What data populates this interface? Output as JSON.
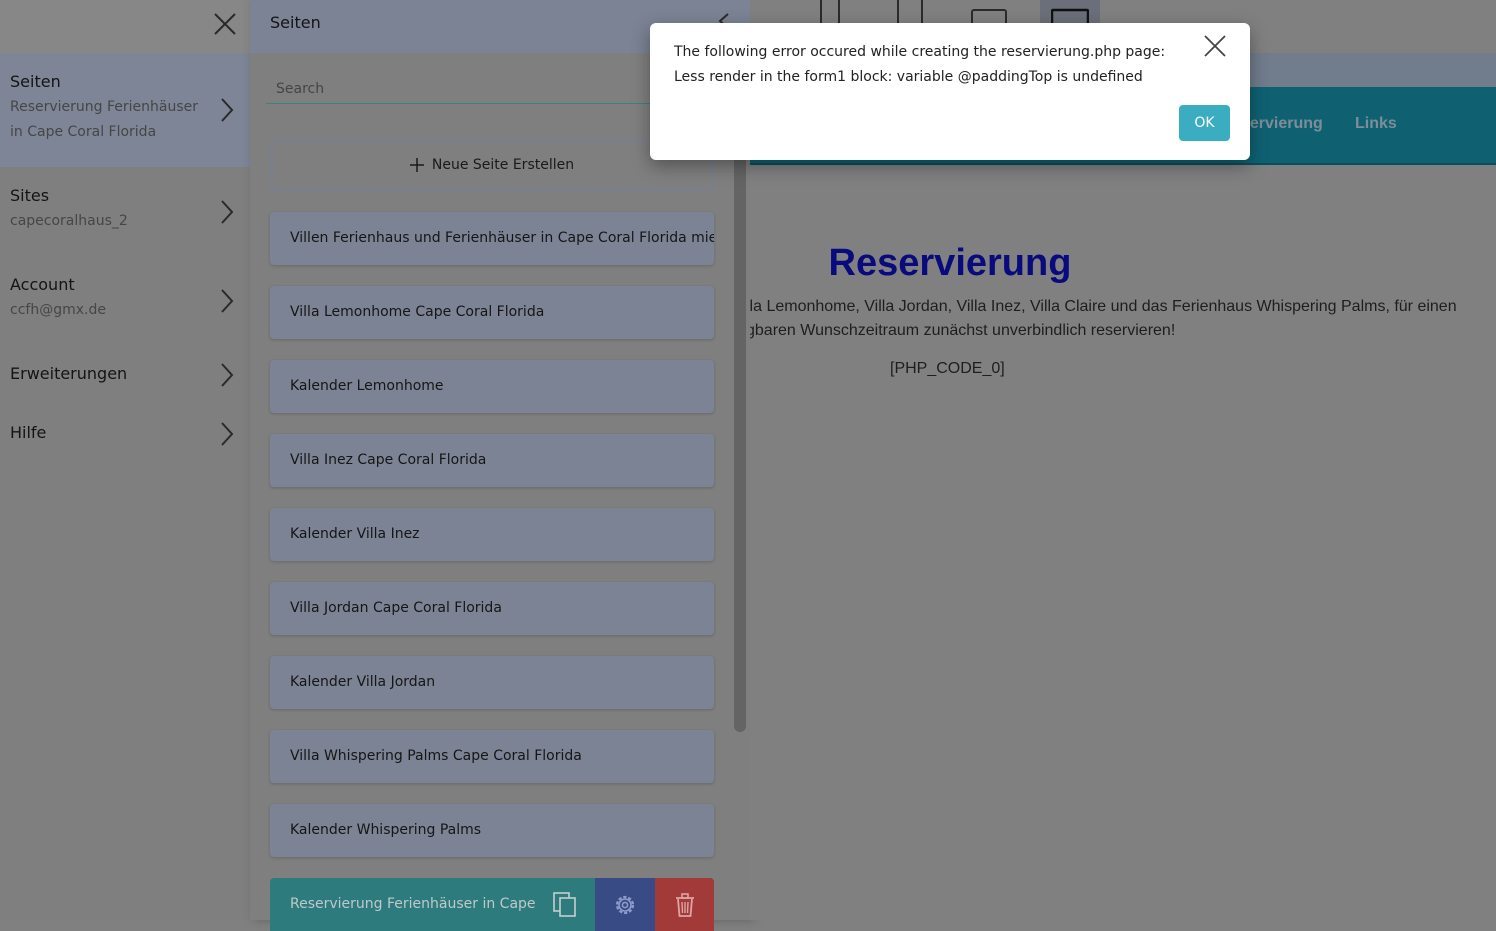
{
  "nav": {
    "items": [
      {
        "label": "Seiten",
        "sub": "Reservierung Ferienhäuser in Cape Coral Florida"
      },
      {
        "label": "Sites",
        "sub": "capecoralhaus_2"
      },
      {
        "label": "Account",
        "sub": "ccfh@gmx.de"
      },
      {
        "label": "Erweiterungen"
      },
      {
        "label": "Hilfe"
      }
    ]
  },
  "pages": {
    "title": "Seiten",
    "search_placeholder": "Search",
    "new_page_label": "Neue Seite Erstellen",
    "items": [
      "Villen Ferienhaus und Ferienhäuser in Cape Coral Florida mieten",
      "Villa Lemonhome Cape Coral Florida",
      "Kalender Lemonhome",
      "Villa Inez Cape Coral Florida",
      "Kalender Villa Inez",
      "Villa Jordan Cape Coral Florida",
      "Kalender Villa Jordan",
      "Villa Whispering Palms Cape Coral Florida",
      "Kalender Whispering Palms"
    ],
    "active_item": "Reservierung Ferienhäuser in Cape"
  },
  "preview": {
    "nav_links": [
      "servierung",
      "Links"
    ],
    "title": "Reservierung",
    "text_line1": "lla Lemonhome, Villa Jordan, Villa Inez, Villa Claire und das Ferienhaus Whispering Palms, für einen",
    "text_line2": "gbaren Wunschzeitraum zunächst unverbindlich reservieren!",
    "code": "[PHP_CODE_0]"
  },
  "modal": {
    "line1": "The following error occured while creating the reservierung.php page:",
    "line2": "Less render in the form1 block: variable @paddingTop is undefined",
    "ok_label": "OK"
  },
  "colors": {
    "accent": "#3aaec0",
    "site_nav": "#0f6172",
    "active_page": "#2e7b7d",
    "delete": "#a33a3a",
    "settings": "#384b84"
  }
}
